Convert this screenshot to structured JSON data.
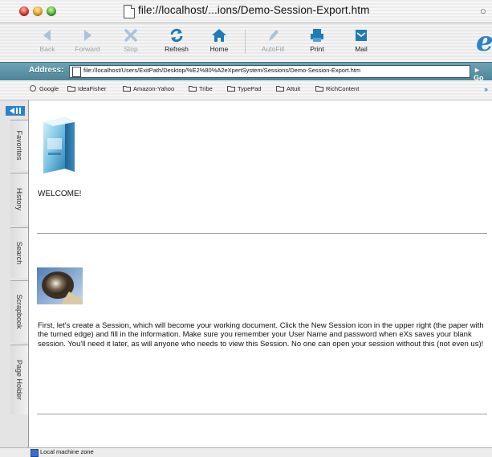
{
  "window": {
    "title": "file://localhost/...ions/Demo-Session-Export.htm"
  },
  "toolbar": {
    "buttons": [
      {
        "label": "Back",
        "icon": "back-arrow-icon",
        "enabled": false
      },
      {
        "label": "Forward",
        "icon": "forward-arrow-icon",
        "enabled": false
      },
      {
        "label": "Stop",
        "icon": "stop-x-icon",
        "enabled": false
      },
      {
        "label": "Refresh",
        "icon": "refresh-icon",
        "enabled": true
      },
      {
        "label": "Home",
        "icon": "home-icon",
        "enabled": true
      },
      {
        "label": "AutoFill",
        "icon": "autofill-pen-icon",
        "enabled": false
      },
      {
        "label": "Print",
        "icon": "printer-icon",
        "enabled": true
      },
      {
        "label": "Mail",
        "icon": "mail-icon",
        "enabled": true
      }
    ]
  },
  "address": {
    "label": "Address:",
    "url": "file://localhost/Users/ExitPath/Desktop/%E2%80%A2eXpertSystem/Sessions/Demo-Session-Export.htm",
    "go": "Go"
  },
  "favorites": [
    {
      "label": "Google",
      "icon": "google-icon"
    },
    {
      "label": "IdeaFisher",
      "icon": "folder-icon"
    },
    {
      "label": "Amazon-Yahoo",
      "icon": "folder-icon"
    },
    {
      "label": "Tribe",
      "icon": "folder-icon"
    },
    {
      "label": "TypePad",
      "icon": "folder-icon"
    },
    {
      "label": "Attuit",
      "icon": "folder-icon"
    },
    {
      "label": "RichContent",
      "icon": "folder-icon"
    }
  ],
  "sidebar": {
    "tabs": [
      "Favorites",
      "History",
      "Search",
      "Scrapbook",
      "Page Holder"
    ]
  },
  "content": {
    "welcome": "WELCOME!",
    "paragraph": "First, let's create a Session, which will become your working document. Click the New Session icon in the upper right (the paper with the turned edge) and fill in the information. Make sure you remember your User Name and password when eXs saves your blank session. You'll need it later, as will anyone who needs to view this Session. No one can open your session without this (not even us)!"
  },
  "status": {
    "zone": "Local machine zone"
  },
  "colors": {
    "accent": "#2b82c9",
    "address_bar": "#4d8599"
  }
}
